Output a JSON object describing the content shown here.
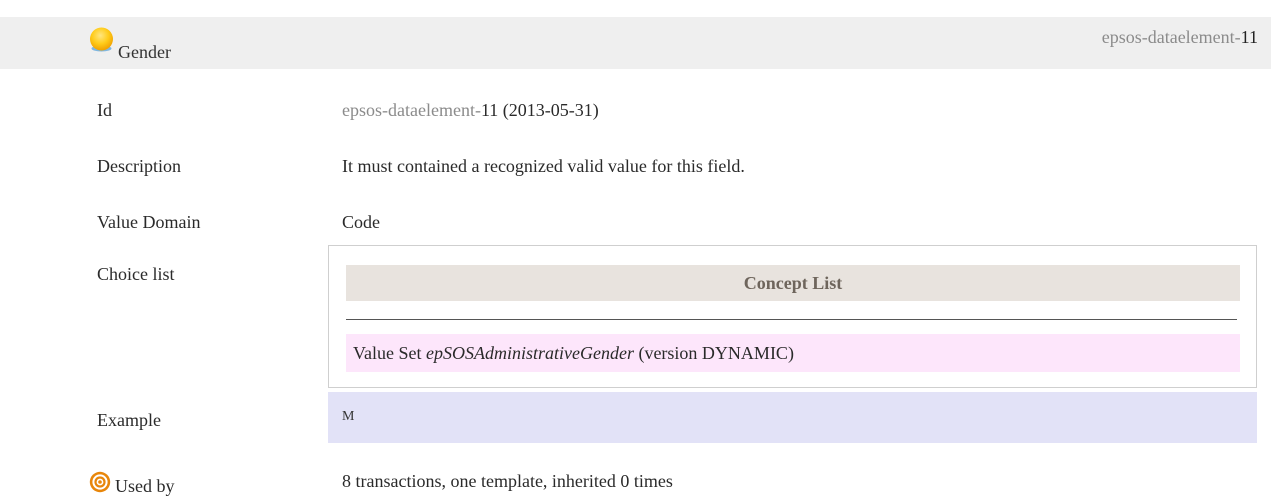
{
  "header": {
    "title": "Gender",
    "id_prefix": "epsos-dataelement-",
    "id_number": "11",
    "icon": "yellow-circle-icon"
  },
  "rows": {
    "id": {
      "label": "Id",
      "value_prefix": "epsos-dataelement-",
      "value_number": "11",
      "value_date": "(2013-05-31)"
    },
    "description": {
      "label": "Description",
      "value": "It must contained a recognized valid value for this field."
    },
    "value_domain": {
      "label": "Value Domain",
      "value": "Code"
    },
    "choice_list": {
      "label": "Choice list",
      "concept_list_header": "Concept List",
      "value_set_prefix": "Value Set",
      "value_set_name": "epSOSAdministrativeGender",
      "value_set_version": "(version DYNAMIC)"
    },
    "example": {
      "label": "Example",
      "value": "M"
    },
    "used_by": {
      "label": "Used by",
      "value": "8 transactions, one template, inherited 0 times",
      "icon": "target-icon"
    }
  },
  "colors": {
    "header_background": "#efefef",
    "muted_text": "#8b8b8b",
    "concept_header_background": "#e8e3de",
    "value_set_background": "#fde6fb",
    "example_background": "#e2e2f7",
    "used_by_icon": "#e8860a"
  }
}
